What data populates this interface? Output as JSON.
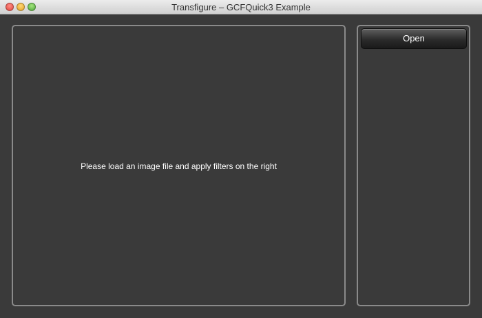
{
  "window": {
    "title": "Transfigure – GCFQuick3 Example",
    "traffic_lights": {
      "close_color": "#e2463d",
      "minimize_color": "#e5a224",
      "maximize_color": "#4ca73a"
    }
  },
  "canvas": {
    "placeholder_text": "Please load an image file and apply filters on the right"
  },
  "sidebar": {
    "open_label": "Open"
  },
  "colors": {
    "background": "#3a3a3a",
    "panel_border": "#8a8a8a",
    "text": "#ffffff"
  }
}
